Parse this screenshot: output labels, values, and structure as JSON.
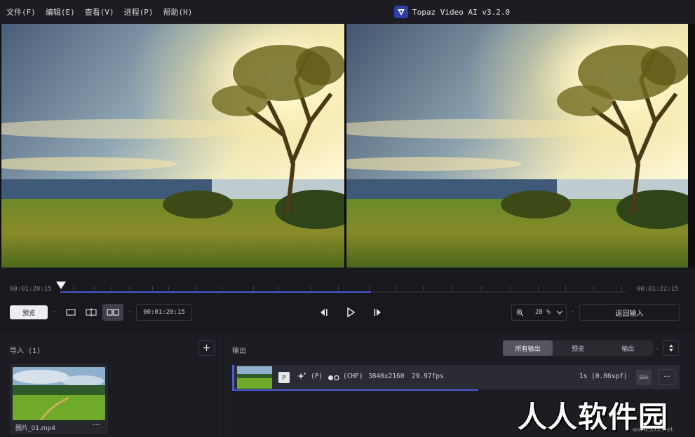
{
  "menu": {
    "items": [
      "文件(F)",
      "编辑(E)",
      "查看(V)",
      "进程(P)",
      "帮助(H)"
    ]
  },
  "app": {
    "title": "Topaz Video AI  v3.2.0"
  },
  "timeline": {
    "start_timecode": "00:01:20:15",
    "end_timecode": "00:01:22:15",
    "progress_fraction": 0.55,
    "playhead_fraction": 0.0
  },
  "controls": {
    "preview_label": "预览",
    "current_timecode": "00:01:20:15",
    "zoom_value": "28 %",
    "back_label": "返回输入",
    "view_modes": [
      "single-view-icon",
      "split-view-icon",
      "side-by-side-view-icon"
    ],
    "active_view_mode": "side-by-side-view-icon"
  },
  "import_panel": {
    "title": "导入 (1)",
    "add_label": "+",
    "file": {
      "name": "图片_01.mp4",
      "more_label": "···"
    }
  },
  "output_panel": {
    "title": "输出",
    "tabs": [
      "所有输出",
      "预览",
      "输出"
    ],
    "active_tab": "所有输出",
    "sort_label": "▲▼",
    "row": {
      "badge": "P",
      "enhance_label": "(P)",
      "frame_label": "(CHF)",
      "resolution": "3840x2160",
      "fps": "29.97fps",
      "time": "1s (0.06spf)",
      "percent": "55%",
      "more_label": "···",
      "progress_fraction": 0.55
    }
  },
  "watermark": {
    "text": "人人软件园",
    "sub": "www.xxx.net"
  },
  "colors": {
    "accent": "#4a5bd6",
    "background": "#17171c",
    "panel": "#1c1c22"
  }
}
